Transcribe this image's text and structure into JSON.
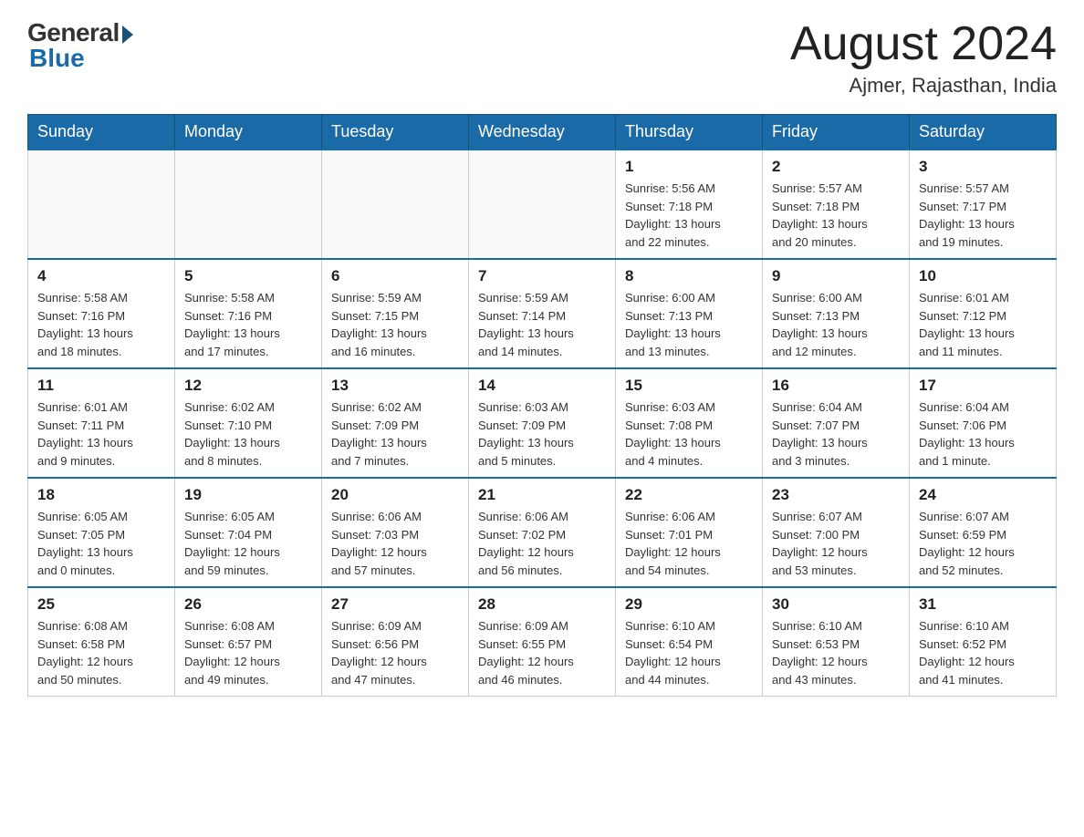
{
  "header": {
    "logo_general": "General",
    "logo_blue": "Blue",
    "month_title": "August 2024",
    "subtitle": "Ajmer, Rajasthan, India"
  },
  "days_of_week": [
    "Sunday",
    "Monday",
    "Tuesday",
    "Wednesday",
    "Thursday",
    "Friday",
    "Saturday"
  ],
  "weeks": [
    [
      {
        "day": "",
        "info": ""
      },
      {
        "day": "",
        "info": ""
      },
      {
        "day": "",
        "info": ""
      },
      {
        "day": "",
        "info": ""
      },
      {
        "day": "1",
        "info": "Sunrise: 5:56 AM\nSunset: 7:18 PM\nDaylight: 13 hours\nand 22 minutes."
      },
      {
        "day": "2",
        "info": "Sunrise: 5:57 AM\nSunset: 7:18 PM\nDaylight: 13 hours\nand 20 minutes."
      },
      {
        "day": "3",
        "info": "Sunrise: 5:57 AM\nSunset: 7:17 PM\nDaylight: 13 hours\nand 19 minutes."
      }
    ],
    [
      {
        "day": "4",
        "info": "Sunrise: 5:58 AM\nSunset: 7:16 PM\nDaylight: 13 hours\nand 18 minutes."
      },
      {
        "day": "5",
        "info": "Sunrise: 5:58 AM\nSunset: 7:16 PM\nDaylight: 13 hours\nand 17 minutes."
      },
      {
        "day": "6",
        "info": "Sunrise: 5:59 AM\nSunset: 7:15 PM\nDaylight: 13 hours\nand 16 minutes."
      },
      {
        "day": "7",
        "info": "Sunrise: 5:59 AM\nSunset: 7:14 PM\nDaylight: 13 hours\nand 14 minutes."
      },
      {
        "day": "8",
        "info": "Sunrise: 6:00 AM\nSunset: 7:13 PM\nDaylight: 13 hours\nand 13 minutes."
      },
      {
        "day": "9",
        "info": "Sunrise: 6:00 AM\nSunset: 7:13 PM\nDaylight: 13 hours\nand 12 minutes."
      },
      {
        "day": "10",
        "info": "Sunrise: 6:01 AM\nSunset: 7:12 PM\nDaylight: 13 hours\nand 11 minutes."
      }
    ],
    [
      {
        "day": "11",
        "info": "Sunrise: 6:01 AM\nSunset: 7:11 PM\nDaylight: 13 hours\nand 9 minutes."
      },
      {
        "day": "12",
        "info": "Sunrise: 6:02 AM\nSunset: 7:10 PM\nDaylight: 13 hours\nand 8 minutes."
      },
      {
        "day": "13",
        "info": "Sunrise: 6:02 AM\nSunset: 7:09 PM\nDaylight: 13 hours\nand 7 minutes."
      },
      {
        "day": "14",
        "info": "Sunrise: 6:03 AM\nSunset: 7:09 PM\nDaylight: 13 hours\nand 5 minutes."
      },
      {
        "day": "15",
        "info": "Sunrise: 6:03 AM\nSunset: 7:08 PM\nDaylight: 13 hours\nand 4 minutes."
      },
      {
        "day": "16",
        "info": "Sunrise: 6:04 AM\nSunset: 7:07 PM\nDaylight: 13 hours\nand 3 minutes."
      },
      {
        "day": "17",
        "info": "Sunrise: 6:04 AM\nSunset: 7:06 PM\nDaylight: 13 hours\nand 1 minute."
      }
    ],
    [
      {
        "day": "18",
        "info": "Sunrise: 6:05 AM\nSunset: 7:05 PM\nDaylight: 13 hours\nand 0 minutes."
      },
      {
        "day": "19",
        "info": "Sunrise: 6:05 AM\nSunset: 7:04 PM\nDaylight: 12 hours\nand 59 minutes."
      },
      {
        "day": "20",
        "info": "Sunrise: 6:06 AM\nSunset: 7:03 PM\nDaylight: 12 hours\nand 57 minutes."
      },
      {
        "day": "21",
        "info": "Sunrise: 6:06 AM\nSunset: 7:02 PM\nDaylight: 12 hours\nand 56 minutes."
      },
      {
        "day": "22",
        "info": "Sunrise: 6:06 AM\nSunset: 7:01 PM\nDaylight: 12 hours\nand 54 minutes."
      },
      {
        "day": "23",
        "info": "Sunrise: 6:07 AM\nSunset: 7:00 PM\nDaylight: 12 hours\nand 53 minutes."
      },
      {
        "day": "24",
        "info": "Sunrise: 6:07 AM\nSunset: 6:59 PM\nDaylight: 12 hours\nand 52 minutes."
      }
    ],
    [
      {
        "day": "25",
        "info": "Sunrise: 6:08 AM\nSunset: 6:58 PM\nDaylight: 12 hours\nand 50 minutes."
      },
      {
        "day": "26",
        "info": "Sunrise: 6:08 AM\nSunset: 6:57 PM\nDaylight: 12 hours\nand 49 minutes."
      },
      {
        "day": "27",
        "info": "Sunrise: 6:09 AM\nSunset: 6:56 PM\nDaylight: 12 hours\nand 47 minutes."
      },
      {
        "day": "28",
        "info": "Sunrise: 6:09 AM\nSunset: 6:55 PM\nDaylight: 12 hours\nand 46 minutes."
      },
      {
        "day": "29",
        "info": "Sunrise: 6:10 AM\nSunset: 6:54 PM\nDaylight: 12 hours\nand 44 minutes."
      },
      {
        "day": "30",
        "info": "Sunrise: 6:10 AM\nSunset: 6:53 PM\nDaylight: 12 hours\nand 43 minutes."
      },
      {
        "day": "31",
        "info": "Sunrise: 6:10 AM\nSunset: 6:52 PM\nDaylight: 12 hours\nand 41 minutes."
      }
    ]
  ]
}
